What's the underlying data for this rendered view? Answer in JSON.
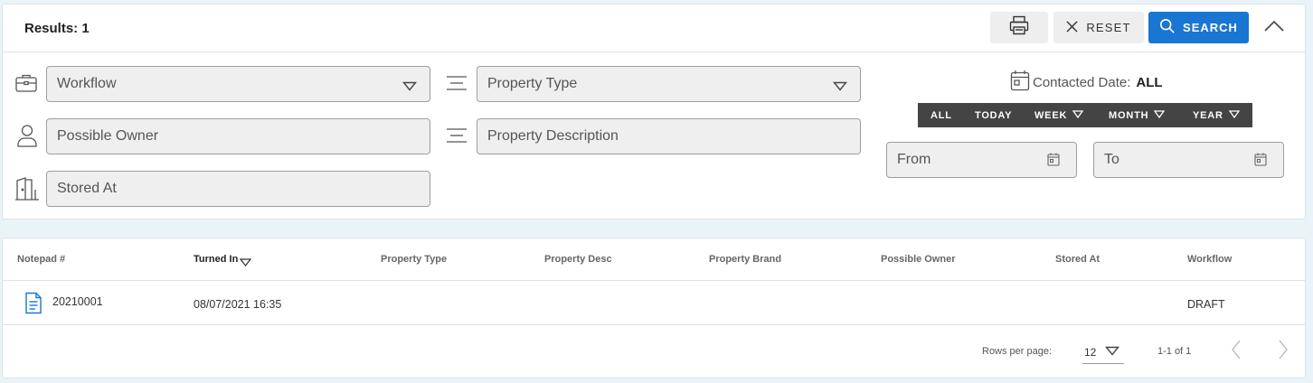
{
  "header": {
    "results_label": "Results: 1",
    "reset_label": "RESET",
    "search_label": "SEARCH"
  },
  "filters": {
    "workflow_placeholder": "Workflow",
    "property_type_placeholder": "Property Type",
    "possible_owner_placeholder": "Possible Owner",
    "property_description_placeholder": "Property Description",
    "stored_at_placeholder": "Stored At",
    "contacted_date_label": "Contacted Date:",
    "contacted_date_value": "ALL",
    "date_tabs": [
      "ALL",
      "TODAY",
      "WEEK",
      "MONTH",
      "YEAR"
    ],
    "from_placeholder": "From",
    "to_placeholder": "To"
  },
  "table": {
    "columns": [
      "Notepad #",
      "Turned In",
      "Property Type",
      "Property Desc",
      "Property Brand",
      "Possible Owner",
      "Stored At",
      "Workflow"
    ],
    "rows": [
      {
        "notepad": "20210001",
        "turned_in": "08/07/2021 16:35",
        "property_type": "",
        "property_desc": "",
        "property_brand": "",
        "possible_owner": "",
        "stored_at": "",
        "workflow": "DRAFT"
      }
    ]
  },
  "pagination": {
    "rows_per_page_label": "Rows per page:",
    "rows_per_page_value": "12",
    "range_label": "1-1 of 1"
  },
  "colors": {
    "accent": "#1976d2",
    "background": "#e9f3f8",
    "date_tab_bar": "#444444",
    "input_fill": "#efefef"
  },
  "icons": [
    "printer-icon",
    "close-icon",
    "search-icon",
    "chevron-up-icon",
    "briefcase-icon",
    "lines-icon",
    "person-icon",
    "door-icon",
    "calendar-icon",
    "caret-down-icon",
    "document-icon",
    "chevron-left-icon",
    "chevron-right-icon"
  ]
}
